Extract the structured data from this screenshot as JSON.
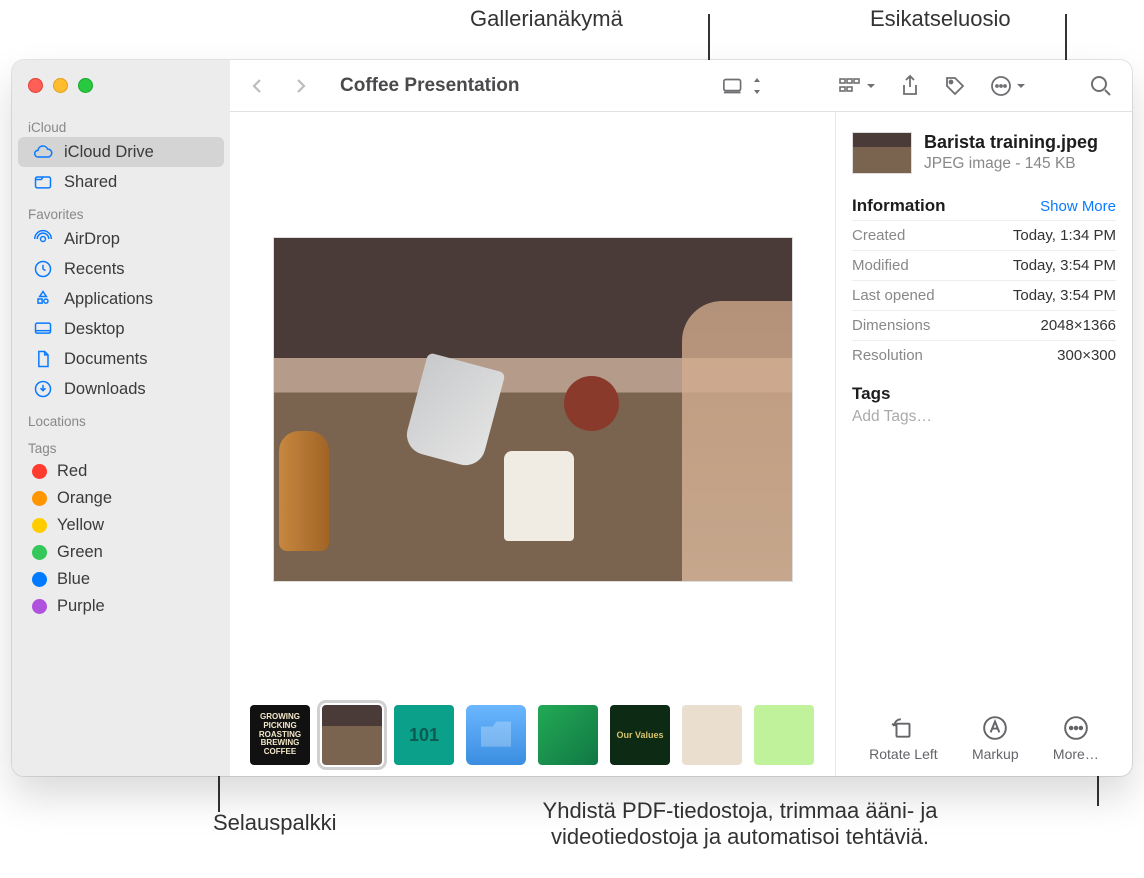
{
  "callouts": {
    "gallery_view": "Gallerianäkymä",
    "preview_area": "Esikatseluosio",
    "scrubber": "Selauspalkki",
    "more_desc": "Yhdistä PDF-tiedostoja, trimmaa ääni- ja videotiedostoja ja automatisoi tehtäviä."
  },
  "toolbar": {
    "title": "Coffee Presentation"
  },
  "sidebar": {
    "sections": {
      "icloud": "iCloud",
      "favorites": "Favorites",
      "locations": "Locations",
      "tags": "Tags"
    },
    "icloud_items": [
      {
        "label": "iCloud Drive",
        "icon": "cloud"
      },
      {
        "label": "Shared",
        "icon": "folder-shared"
      }
    ],
    "favorites": [
      {
        "label": "AirDrop",
        "icon": "airdrop"
      },
      {
        "label": "Recents",
        "icon": "clock"
      },
      {
        "label": "Applications",
        "icon": "apps"
      },
      {
        "label": "Desktop",
        "icon": "desktop"
      },
      {
        "label": "Documents",
        "icon": "doc"
      },
      {
        "label": "Downloads",
        "icon": "download"
      }
    ],
    "tags": [
      {
        "label": "Red",
        "color": "#ff3b30"
      },
      {
        "label": "Orange",
        "color": "#ff9500"
      },
      {
        "label": "Yellow",
        "color": "#ffcc00"
      },
      {
        "label": "Green",
        "color": "#34c759"
      },
      {
        "label": "Blue",
        "color": "#007aff"
      },
      {
        "label": "Purple",
        "color": "#af52de"
      }
    ]
  },
  "preview": {
    "filename": "Barista training.jpeg",
    "subtitle": "JPEG image - 145 KB",
    "info_label": "Information",
    "show_more": "Show More",
    "rows": [
      {
        "k": "Created",
        "v": "Today, 1:34 PM"
      },
      {
        "k": "Modified",
        "v": "Today, 3:54 PM"
      },
      {
        "k": "Last opened",
        "v": "Today, 3:54 PM"
      },
      {
        "k": "Dimensions",
        "v": "2048×1366"
      },
      {
        "k": "Resolution",
        "v": "300×300"
      }
    ],
    "tags_label": "Tags",
    "add_tags": "Add Tags…",
    "actions": {
      "rotate": "Rotate Left",
      "markup": "Markup",
      "more": "More…"
    }
  },
  "thumbs": [
    {
      "label": "GROWING PICKING ROASTING BREWING COFFEE",
      "bg": "#111",
      "fg": "#f3e7c9"
    },
    {
      "label": "",
      "bg": "",
      "fg": ""
    },
    {
      "label": "101",
      "bg": "#0aa08a",
      "fg": "#0d5b52"
    },
    {
      "label": "",
      "bg": "#4aa6ff",
      "fg": ""
    },
    {
      "label": "",
      "bg": "#2a4",
      "fg": ""
    },
    {
      "label": "Our Values",
      "bg": "#0c2a14",
      "fg": "#d8c36a"
    },
    {
      "label": "",
      "bg": "#eadfce",
      "fg": ""
    },
    {
      "label": "",
      "bg": "#bff29a",
      "fg": "#333"
    }
  ]
}
